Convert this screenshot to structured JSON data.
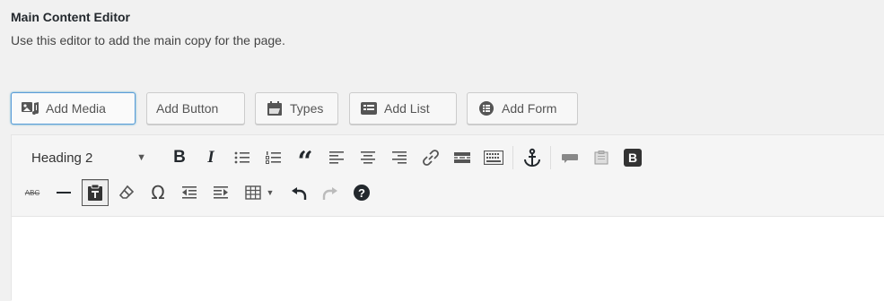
{
  "field": {
    "label": "Main Content Editor",
    "description": "Use this editor to add the main copy for the page."
  },
  "media_buttons": [
    {
      "label": "Add Media",
      "icon": "add-media-icon"
    },
    {
      "label": "Add Button",
      "icon": ""
    },
    {
      "label": "Types",
      "icon": "types-icon"
    },
    {
      "label": "Add List",
      "icon": "list-icon"
    },
    {
      "label": "Add Form",
      "icon": "form-icon"
    }
  ],
  "toolbar": {
    "format_select": "Heading 2",
    "row1_icons": [
      "bold-icon",
      "italic-icon",
      "bulleted-list-icon",
      "numbered-list-icon",
      "blockquote-icon",
      "align-left-icon",
      "align-center-icon",
      "align-right-icon",
      "link-icon",
      "read-more-icon",
      "toolbar-toggle-icon",
      "anchor-icon",
      "comment-icon",
      "clipboard-icon",
      "bootstrap-icon"
    ],
    "row2_icons": [
      "strikethrough-icon",
      "horizontal-line-icon",
      "paste-as-text-icon",
      "clear-formatting-icon",
      "special-character-icon",
      "outdent-icon",
      "indent-icon",
      "table-icon",
      "undo-icon",
      "redo-icon",
      "help-icon"
    ],
    "bold_glyph": "B",
    "italic_glyph": "I",
    "quote_glyph": "“",
    "omega_glyph": "Ω",
    "strike_glyph": "ABC",
    "bootstrap_glyph": "B",
    "help_glyph": "?"
  },
  "colors": {
    "accent": "#0073aa",
    "toolbar_icon": "#555555",
    "background": "#f1f1f1"
  }
}
